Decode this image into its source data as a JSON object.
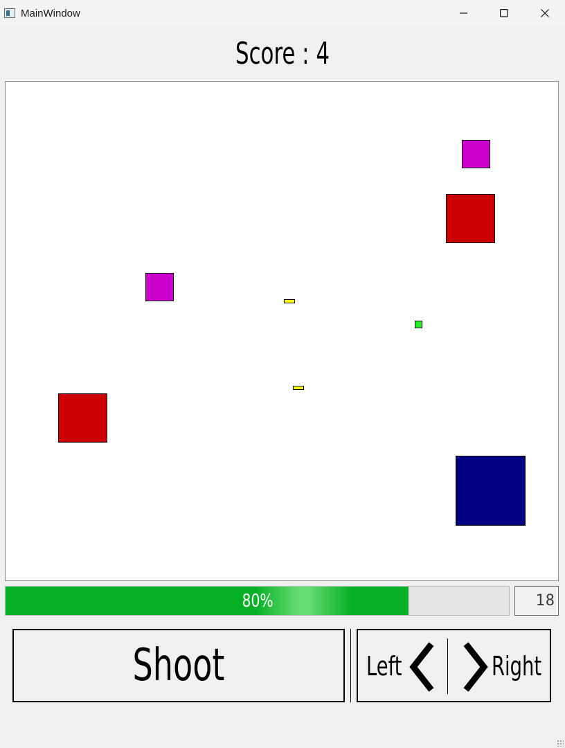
{
  "window": {
    "title": "MainWindow",
    "controls": [
      "minimize-icon",
      "maximize-icon",
      "close-icon"
    ]
  },
  "score": {
    "label": "Score : 4",
    "value": 4
  },
  "game": {
    "background": "#ffffff",
    "enemies": [
      {
        "kind": "small",
        "color": "#cc00cc"
      },
      {
        "kind": "medium",
        "color": "#cc0000"
      },
      {
        "kind": "small",
        "color": "#cc00cc"
      },
      {
        "kind": "medium",
        "color": "#cc0000"
      },
      {
        "kind": "large",
        "color": "#000080"
      }
    ],
    "bullets_color": "#ffff00",
    "player_color": "#22ee22"
  },
  "progress": {
    "text": "80%",
    "value_percent": 80,
    "color": "#06b025"
  },
  "lcd": {
    "text": "18"
  },
  "controls": {
    "shoot_label": "Shoot",
    "left_label": "Left",
    "right_label": "Right"
  }
}
